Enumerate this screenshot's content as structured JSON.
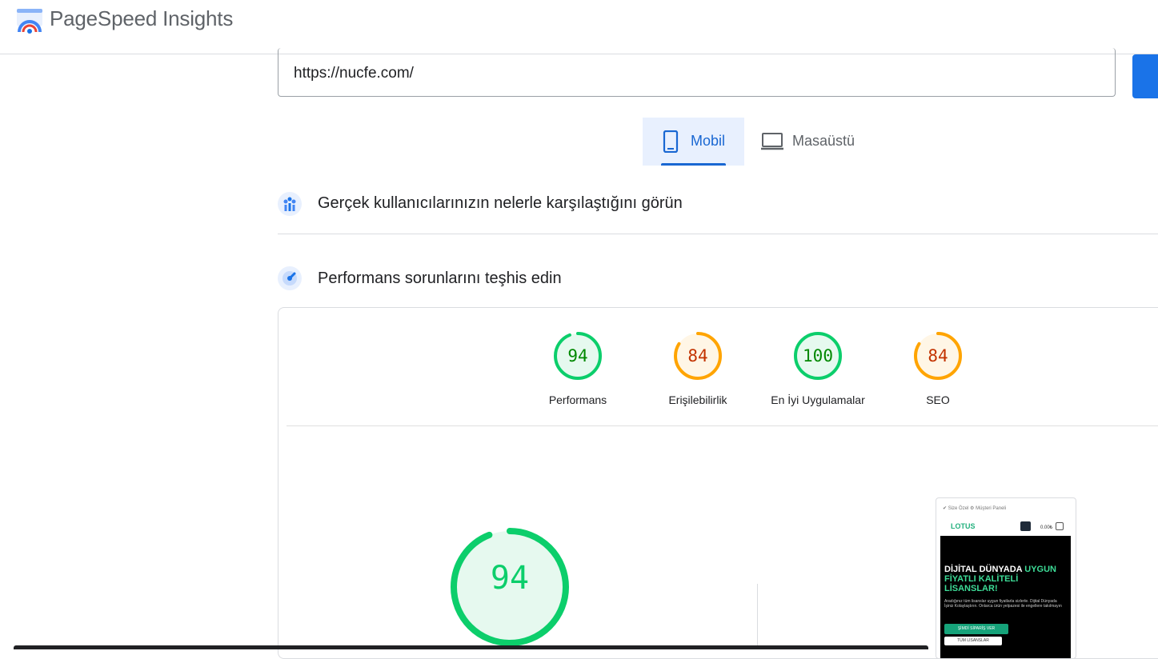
{
  "header": {
    "title": "PageSpeed Insights"
  },
  "search": {
    "url_value": "https://nucfe.com/"
  },
  "tabs": [
    {
      "label": "Mobil",
      "icon": "smartphone-icon",
      "selected": true
    },
    {
      "label": "Masaüstü",
      "icon": "laptop-icon",
      "selected": false
    }
  ],
  "sections": {
    "field_data": {
      "title": "Gerçek kullanıcılarınızın nelerle karşılaştığını görün",
      "icon": "users-chart-icon"
    },
    "lab_data": {
      "title": "Performans sorunlarını teşhis edin",
      "icon": "lighthouse-icon"
    }
  },
  "scores": [
    {
      "label": "Performans",
      "score": "94",
      "color": "#0cce6b"
    },
    {
      "label": "Erişilebilirlik",
      "score": "84",
      "color": "#ffa400"
    },
    {
      "label": "En İyi Uygulamalar",
      "score": "100",
      "color": "#0cce6b"
    },
    {
      "label": "SEO",
      "score": "84",
      "color": "#ffa400"
    }
  ],
  "main_score": {
    "score": "94",
    "color": "#0cce6b"
  },
  "screenshot": {
    "topbar": "✔ Size Özel   ⚙ Müşteri Paneli",
    "logo": "LOTUS",
    "price": "0.00₺",
    "headline_white": "DİJİTAL DÜNYADA",
    "headline_green": "UYGUN FİYATLI KALİTELİ LİSANSLAR!",
    "paragraph": "Aradığınız tüm lisanslar uygun fiyatlarla sizlerle. Dijital Dünyada İşiniz Kolaylaştırın. Onlarca ürün yelpazesi ile engellere takılmayın",
    "button_primary": "ŞİMDİ SİPARİŞ VER",
    "button_secondary": "TÜM LİSANSLAR"
  },
  "colors": {
    "accent": "#1a73e8",
    "pass": "#0cce6b",
    "average": "#ffa400"
  }
}
